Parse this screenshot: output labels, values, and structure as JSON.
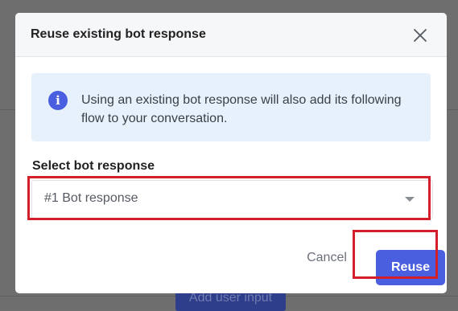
{
  "background": {
    "button_label": "Add user input"
  },
  "dialog": {
    "title": "Reuse existing bot response",
    "close_icon": "close-icon",
    "info": {
      "icon": "info-icon",
      "icon_glyph": "i",
      "text": "Using an existing bot response will also add its following flow to your conversation."
    },
    "select": {
      "label": "Select bot response",
      "value": "#1 Bot response",
      "caret_icon": "caret-down-icon"
    },
    "buttons": {
      "cancel": "Cancel",
      "reuse": "Reuse"
    }
  },
  "colors": {
    "accent": "#4a5ee0",
    "info_bg": "#e6f1fb",
    "highlight": "#d21f2a",
    "overlay": "#6e6e6e"
  }
}
